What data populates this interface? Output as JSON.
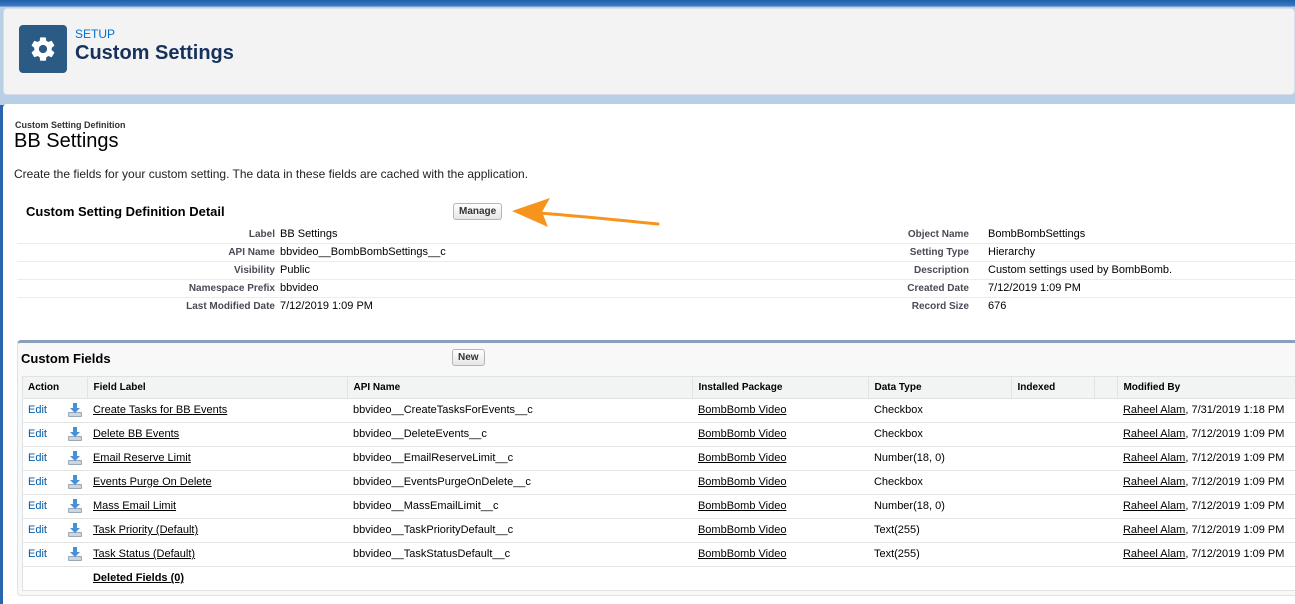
{
  "setup_header": {
    "eyebrow": "SETUP",
    "title": "Custom Settings",
    "icon": "gear-icon"
  },
  "page": {
    "breadcrumb": "Custom Setting Definition",
    "title": "BB Settings",
    "description": "Create the fields for your custom setting. The data in these fields are cached with the application."
  },
  "detail": {
    "title": "Custom Setting Definition Detail",
    "manage_label": "Manage",
    "left": [
      {
        "label": "Label",
        "value": "BB Settings"
      },
      {
        "label": "API Name",
        "value": "bbvideo__BombBombSettings__c"
      },
      {
        "label": "Visibility",
        "value": "Public"
      },
      {
        "label": "Namespace Prefix",
        "value": "bbvideo"
      },
      {
        "label": "Last Modified Date",
        "value": "7/12/2019 1:09 PM"
      }
    ],
    "right": [
      {
        "label": "Object Name",
        "value": "BombBombSettings"
      },
      {
        "label": "Setting Type",
        "value": "Hierarchy"
      },
      {
        "label": "Description",
        "value": "Custom settings used by BombBomb."
      },
      {
        "label": "Created Date",
        "value": "7/12/2019 1:09 PM"
      },
      {
        "label": "Record Size",
        "value": "676"
      }
    ]
  },
  "custom_fields": {
    "title": "Custom Fields",
    "new_label": "New",
    "columns": [
      "Action",
      "Field Label",
      "API Name",
      "Installed Package",
      "Data Type",
      "Indexed",
      "",
      "Modified By"
    ],
    "rows": [
      {
        "action": "Edit",
        "field_label": "Create Tasks for BB Events",
        "api_name": "bbvideo__CreateTasksForEvents__c",
        "package": "BombBomb Video",
        "data_type": "Checkbox",
        "indexed": "",
        "modified_by": "Raheel Alam",
        "modified_date": ", 7/31/2019 1:18 PM"
      },
      {
        "action": "Edit",
        "field_label": "Delete BB Events",
        "api_name": "bbvideo__DeleteEvents__c",
        "package": "BombBomb Video",
        "data_type": "Checkbox",
        "indexed": "",
        "modified_by": "Raheel Alam",
        "modified_date": ", 7/12/2019 1:09 PM"
      },
      {
        "action": "Edit",
        "field_label": "Email Reserve Limit",
        "api_name": "bbvideo__EmailReserveLimit__c",
        "package": "BombBomb Video",
        "data_type": "Number(18, 0)",
        "indexed": "",
        "modified_by": "Raheel Alam",
        "modified_date": ", 7/12/2019 1:09 PM"
      },
      {
        "action": "Edit",
        "field_label": "Events Purge On Delete",
        "api_name": "bbvideo__EventsPurgeOnDelete__c",
        "package": "BombBomb Video",
        "data_type": "Checkbox",
        "indexed": "",
        "modified_by": "Raheel Alam",
        "modified_date": ", 7/12/2019 1:09 PM"
      },
      {
        "action": "Edit",
        "field_label": "Mass Email Limit",
        "api_name": "bbvideo__MassEmailLimit__c",
        "package": "BombBomb Video",
        "data_type": "Number(18, 0)",
        "indexed": "",
        "modified_by": "Raheel Alam",
        "modified_date": ", 7/12/2019 1:09 PM"
      },
      {
        "action": "Edit",
        "field_label": "Task Priority (Default)",
        "api_name": "bbvideo__TaskPriorityDefault__c",
        "package": "BombBomb Video",
        "data_type": "Text(255)",
        "indexed": "",
        "modified_by": "Raheel Alam",
        "modified_date": ", 7/12/2019 1:09 PM"
      },
      {
        "action": "Edit",
        "field_label": "Task Status (Default)",
        "api_name": "bbvideo__TaskStatusDefault__c",
        "package": "BombBomb Video",
        "data_type": "Text(255)",
        "indexed": "",
        "modified_by": "Raheel Alam",
        "modified_date": ", 7/12/2019 1:09 PM"
      }
    ],
    "deleted_fields": "Deleted Fields (0)"
  },
  "colors": {
    "setup_icon_bg": "#2b5b84",
    "link_blue": "#015ba7",
    "annotation_arrow": "#f7941d"
  }
}
